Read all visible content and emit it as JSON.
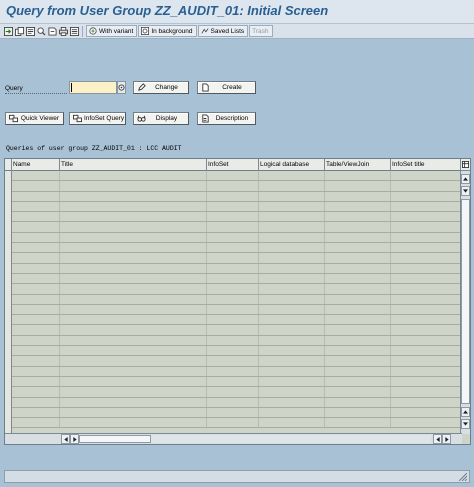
{
  "window": {
    "title": "Query from User Group ZZ_AUDIT_01: Initial Screen"
  },
  "toolbar": {
    "icons": [
      "execute-icon",
      "copy-icon",
      "execute-print-icon",
      "choice-icon",
      "get-icon",
      "print-icon",
      "details-icon"
    ],
    "with_variant": "With variant",
    "in_background": "In background",
    "saved_lists": "Saved Lists",
    "trash": "Trash"
  },
  "query": {
    "label": "Query",
    "value": "",
    "change_label": "Change",
    "create_label": "Create"
  },
  "actions": {
    "quick_viewer": "Quick Viewer",
    "infoset_query": "InfoSet Query",
    "display": "Display",
    "description": "Description"
  },
  "grid": {
    "caption": "Queries of user group ZZ_AUDIT_01 : LCC AUDIT",
    "columns": [
      "Name",
      "Title",
      "InfoSet",
      "Logical database",
      "Table/ViewJoin",
      "InfoSet title"
    ],
    "rows": []
  },
  "colors": {
    "title": "#2a5f92",
    "background": "#a8c1d4",
    "input_required": "#fbf0c6"
  }
}
